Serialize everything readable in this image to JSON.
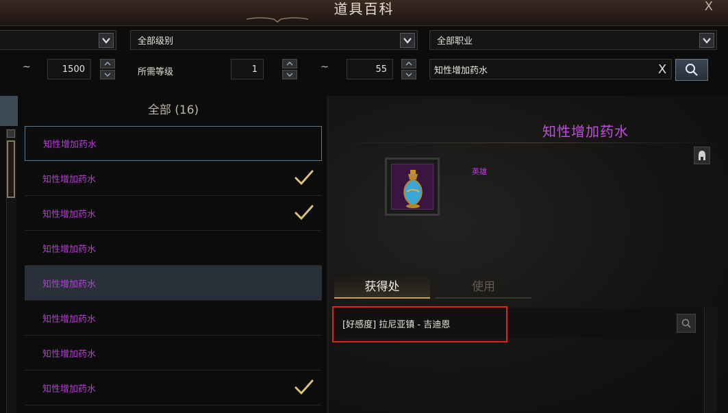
{
  "window": {
    "title": "道具百科",
    "close_label": "X"
  },
  "filters": {
    "select1": {
      "value": ""
    },
    "select_level": {
      "value": "全部级别"
    },
    "select_class": {
      "value": "全部职业"
    },
    "range1": {
      "tilde": "~",
      "max": "1500"
    },
    "required_level": {
      "label": "所需等级",
      "min": "1",
      "tilde": "~",
      "max": "55"
    },
    "search": {
      "value": "知性增加药水",
      "clear_label": "X"
    }
  },
  "list": {
    "header": "全部 (16)",
    "items": [
      {
        "label": "知性增加药水",
        "checked": false
      },
      {
        "label": "知性增加药水",
        "checked": true
      },
      {
        "label": "知性增加药水",
        "checked": true
      },
      {
        "label": "知性增加药水",
        "checked": false
      },
      {
        "label": "知性增加药水",
        "checked": false
      },
      {
        "label": "知性增加药水",
        "checked": false
      },
      {
        "label": "知性增加药水",
        "checked": false
      },
      {
        "label": "知性增加药水",
        "checked": true
      }
    ]
  },
  "detail": {
    "item_name": "知性增加药水",
    "rarity": "英雄",
    "tabs": [
      {
        "label": "获得处"
      },
      {
        "label": "使用"
      }
    ],
    "sources": [
      {
        "text": "[好感度] 拉尼亚镇 - 吉迪恩"
      }
    ]
  },
  "colors": {
    "item_purple": "#b63fd4",
    "highlight_red": "#e0221e",
    "accent_gold": "#c9a45a"
  }
}
